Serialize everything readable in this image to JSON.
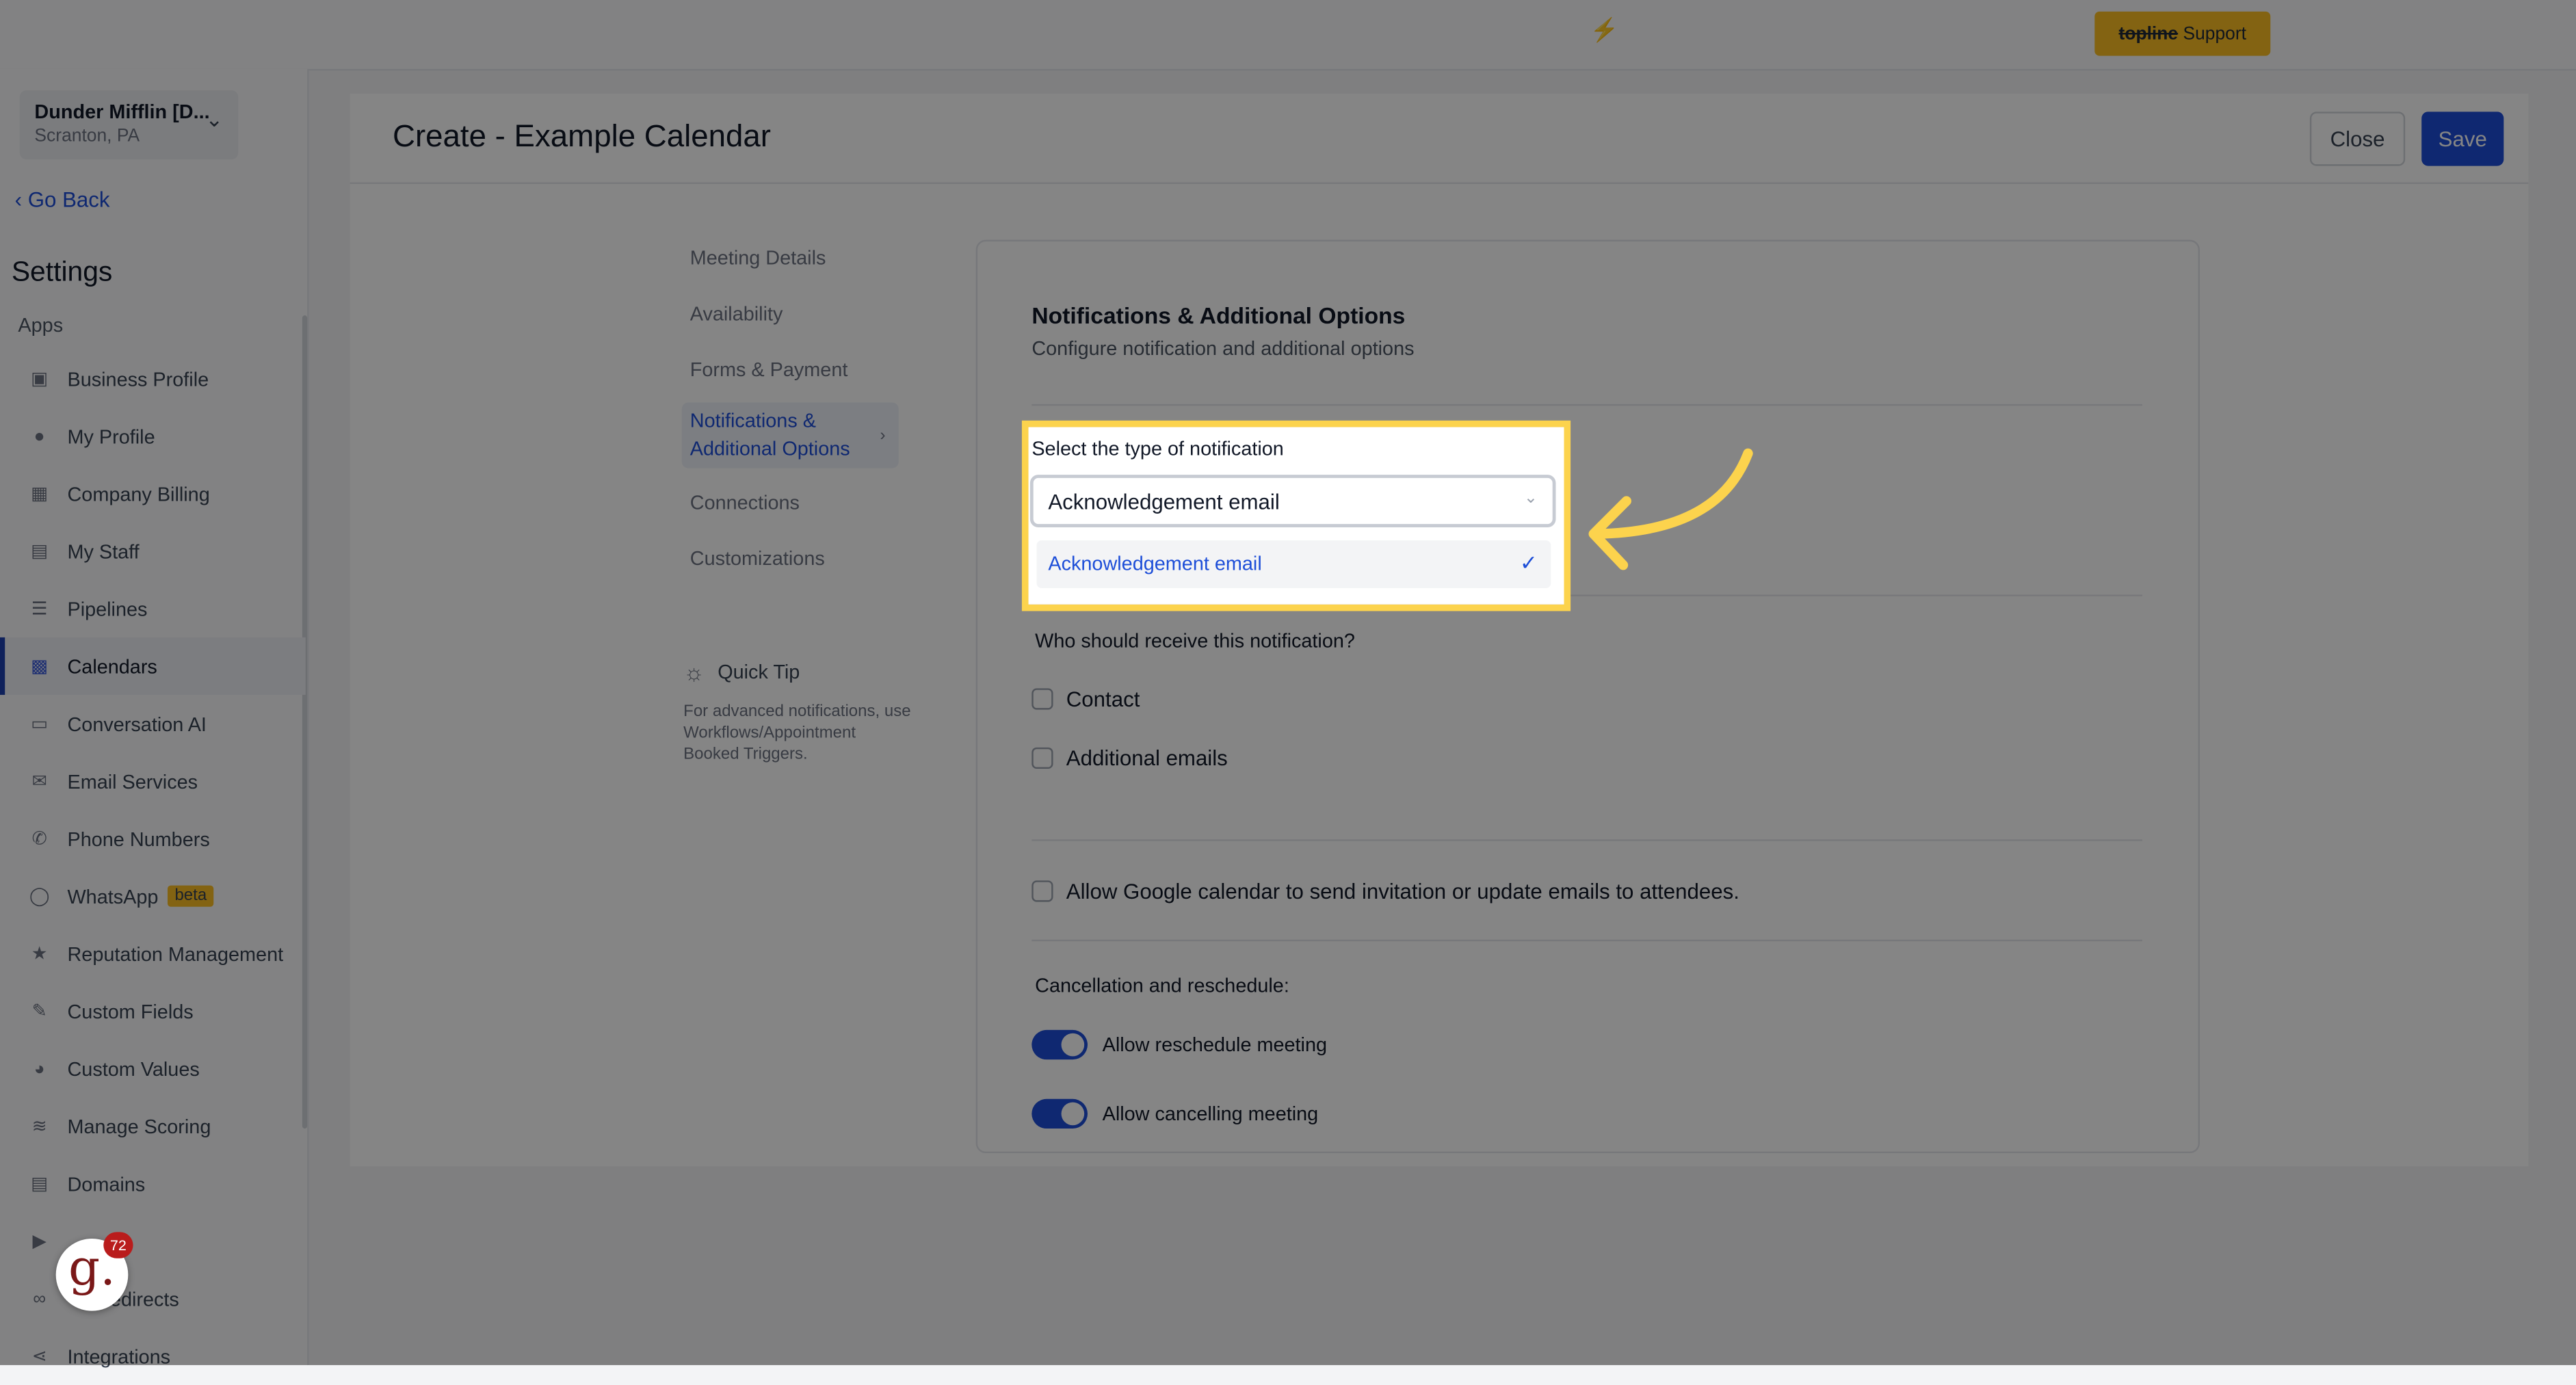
{
  "topbar": {
    "support_brand": "topline",
    "support_label": "Support",
    "bolt_icon": "⚡"
  },
  "account": {
    "name": "Dunder Mifflin [D...",
    "location": "Scranton, PA"
  },
  "sidebar": {
    "go_back": "Go Back",
    "title": "Settings",
    "section_label": "Apps",
    "items": [
      {
        "label": "Business Profile",
        "icon": "briefcase-icon"
      },
      {
        "label": "My Profile",
        "icon": "user-icon"
      },
      {
        "label": "Company Billing",
        "icon": "grid-icon"
      },
      {
        "label": "My Staff",
        "icon": "staff-icon"
      },
      {
        "label": "Pipelines",
        "icon": "filter-icon"
      },
      {
        "label": "Calendars",
        "icon": "calendar-icon",
        "active": true
      },
      {
        "label": "Conversation AI",
        "icon": "chat-icon"
      },
      {
        "label": "Email Services",
        "icon": "mail-icon"
      },
      {
        "label": "Phone Numbers",
        "icon": "phone-icon"
      },
      {
        "label": "WhatsApp",
        "icon": "whatsapp-icon",
        "badge": "beta"
      },
      {
        "label": "Reputation Management",
        "icon": "star-icon"
      },
      {
        "label": "Custom Fields",
        "icon": "edit-icon"
      },
      {
        "label": "Custom Values",
        "icon": "pie-icon"
      },
      {
        "label": "Manage Scoring",
        "icon": "chart-icon"
      },
      {
        "label": "Domains",
        "icon": "domain-icon"
      },
      {
        "label": "",
        "icon": "video-icon"
      },
      {
        "label": "edirects",
        "icon": "link-icon"
      },
      {
        "label": "Integrations",
        "icon": "integrations-icon"
      }
    ],
    "avatar_letter": "g.",
    "avatar_badge": "72"
  },
  "header": {
    "title": "Create - Example Calendar",
    "close_label": "Close",
    "save_label": "Save"
  },
  "subnav": {
    "items": [
      {
        "label": "Meeting Details"
      },
      {
        "label": "Availability"
      },
      {
        "label": "Forms & Payment"
      },
      {
        "label": "Notifications & Additional Options",
        "active": true
      },
      {
        "label": "Connections"
      },
      {
        "label": "Customizations"
      }
    ]
  },
  "quick_tip": {
    "title": "Quick Tip",
    "body": "For advanced notifications, use Workflows/Appointment Booked Triggers."
  },
  "card": {
    "title": "Notifications & Additional Options",
    "subtitle": "Configure notification and additional options",
    "notification_type_label": "Select the type of notification",
    "notification_type_value": "Acknowledgement email",
    "dropdown_options": [
      "Acknowledgement email"
    ],
    "receive_label": "Who should receive this notification?",
    "contact_label": "Contact",
    "additional_emails_label": "Additional emails",
    "google_label": "Allow Google calendar to send invitation or update emails to attendees.",
    "cancellation_label": "Cancellation and reschedule:",
    "toggles": [
      {
        "label": "Allow reschedule meeting",
        "on": true
      },
      {
        "label": "Allow cancelling meeting",
        "on": true
      }
    ]
  },
  "colors": {
    "accent": "#1d4ed8",
    "highlight": "#fcd34d",
    "support": "#fbbf24"
  }
}
